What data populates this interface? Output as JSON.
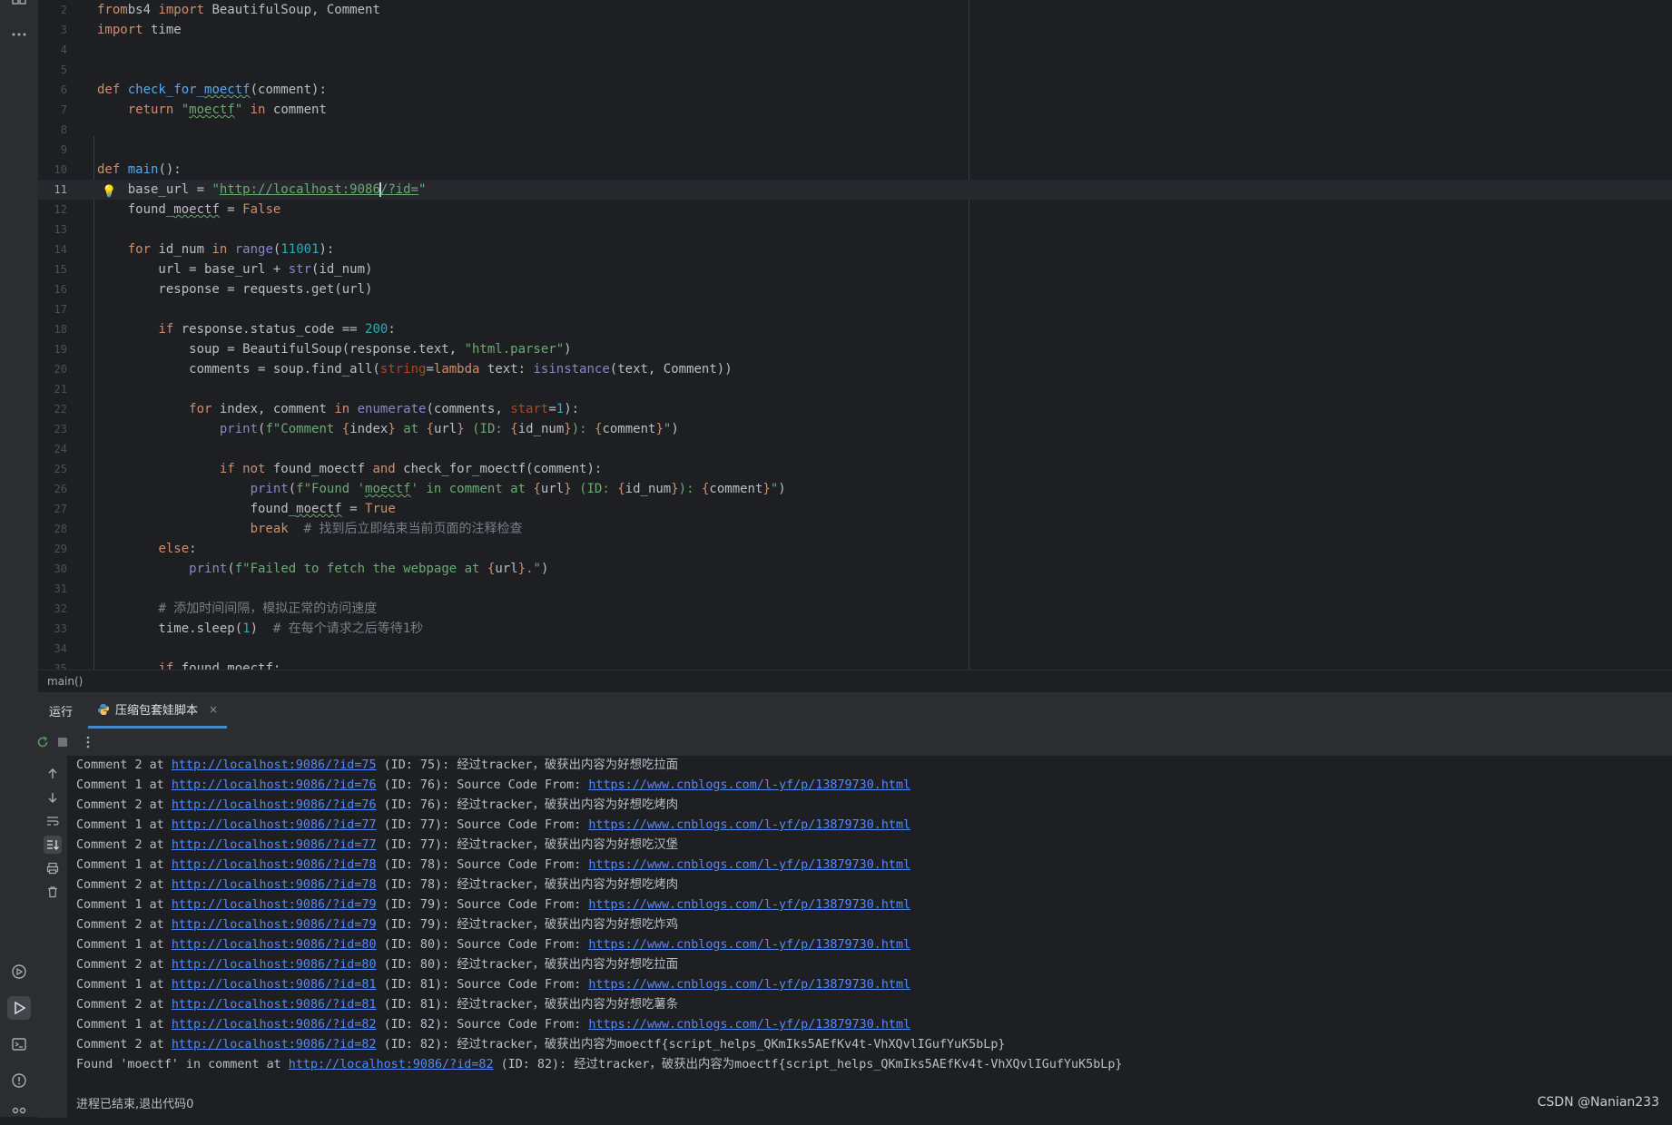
{
  "editor": {
    "lines": [
      {
        "n": "2",
        "tokens": [
          [
            "kw",
            "from"
          ],
          [
            "",
            "bs4 "
          ],
          [
            "kw",
            "import"
          ],
          [
            "",
            " BeautifulSoup, Comment"
          ]
        ]
      },
      {
        "n": "3",
        "tokens": [
          [
            "kw",
            "import"
          ],
          [
            "",
            " time"
          ]
        ]
      },
      {
        "n": "4",
        "tokens": []
      },
      {
        "n": "5",
        "tokens": []
      },
      {
        "n": "6",
        "tokens": [
          [
            "kw",
            "def "
          ],
          [
            "fn",
            "check_for_"
          ],
          [
            "fn typo",
            "moectf"
          ],
          [
            "",
            "(comment):"
          ]
        ]
      },
      {
        "n": "7",
        "tokens": [
          [
            "",
            "    "
          ],
          [
            "kw",
            "return "
          ],
          [
            "str",
            "\""
          ],
          [
            "str typo",
            "moectf"
          ],
          [
            "str",
            "\""
          ],
          [
            "kw",
            " in"
          ],
          [
            "",
            " comment"
          ]
        ]
      },
      {
        "n": "8",
        "tokens": []
      },
      {
        "n": "9",
        "tokens": []
      },
      {
        "n": "10",
        "tokens": [
          [
            "kw",
            "def "
          ],
          [
            "fn",
            "main"
          ],
          [
            "",
            "():"
          ]
        ]
      },
      {
        "n": "11",
        "tokens": [
          [
            "",
            "    base_url = "
          ],
          [
            "str",
            "\""
          ],
          [
            "str url-u",
            "http://localhost:9086"
          ],
          [
            "cursor",
            ""
          ],
          [
            "str url-u",
            "/?id="
          ],
          [
            "str",
            "\""
          ]
        ],
        "current": true
      },
      {
        "n": "12",
        "tokens": [
          [
            "",
            "    found_"
          ],
          [
            "typo",
            "moectf"
          ],
          [
            "",
            " = "
          ],
          [
            "kw",
            "False"
          ]
        ]
      },
      {
        "n": "13",
        "tokens": []
      },
      {
        "n": "14",
        "tokens": [
          [
            "",
            "    "
          ],
          [
            "kw",
            "for"
          ],
          [
            "",
            " id_num "
          ],
          [
            "kw",
            "in "
          ],
          [
            "bi",
            "range"
          ],
          [
            "",
            "("
          ],
          [
            "num",
            "1"
          ],
          [
            ", "
          ],
          [
            "num",
            "1001"
          ],
          [
            "",
            "):"
          ]
        ]
      },
      {
        "n": "15",
        "tokens": [
          [
            "",
            "        url = base_url + "
          ],
          [
            "bi",
            "str"
          ],
          [
            "",
            "(id_num)"
          ]
        ]
      },
      {
        "n": "16",
        "tokens": [
          [
            "",
            "        response = requests.get(url)"
          ]
        ]
      },
      {
        "n": "17",
        "tokens": []
      },
      {
        "n": "18",
        "tokens": [
          [
            "",
            "        "
          ],
          [
            "kw",
            "if"
          ],
          [
            "",
            " response.status_code == "
          ],
          [
            "num",
            "200"
          ],
          [
            "",
            ":"
          ]
        ]
      },
      {
        "n": "19",
        "tokens": [
          [
            "",
            "            soup = BeautifulSoup(response.text, "
          ],
          [
            "str",
            "\"html.parser\""
          ],
          [
            "",
            ")"
          ]
        ]
      },
      {
        "n": "20",
        "tokens": [
          [
            "",
            "            comments = soup.find_all("
          ],
          [
            "param",
            "string"
          ],
          [
            "",
            "="
          ],
          [
            "kw",
            "lambda"
          ],
          [
            "",
            " text: "
          ],
          [
            "bi",
            "isinstance"
          ],
          [
            "",
            "(text, Comment))"
          ]
        ]
      },
      {
        "n": "21",
        "tokens": []
      },
      {
        "n": "22",
        "tokens": [
          [
            "",
            "            "
          ],
          [
            "kw",
            "for"
          ],
          [
            "",
            " index, comment "
          ],
          [
            "kw",
            "in "
          ],
          [
            "bi",
            "enumerate"
          ],
          [
            "",
            "(comments, "
          ],
          [
            "param",
            "start"
          ],
          [
            "",
            "="
          ],
          [
            "num",
            "1"
          ],
          [
            "",
            "):"
          ]
        ]
      },
      {
        "n": "23",
        "tokens": [
          [
            "",
            "                "
          ],
          [
            "bi",
            "print"
          ],
          [
            "",
            "("
          ],
          [
            "str",
            "f\"Comment "
          ],
          [
            "kw",
            "{"
          ],
          [
            "",
            "index"
          ],
          [
            "kw",
            "}"
          ],
          [
            "str",
            " at "
          ],
          [
            "kw",
            "{"
          ],
          [
            "",
            "url"
          ],
          [
            "kw",
            "}"
          ],
          [
            "str",
            " (ID: "
          ],
          [
            "kw",
            "{"
          ],
          [
            "",
            "id_num"
          ],
          [
            "kw",
            "}"
          ],
          [
            "str",
            "): "
          ],
          [
            "kw",
            "{"
          ],
          [
            "",
            "comment"
          ],
          [
            "kw",
            "}"
          ],
          [
            "str",
            "\""
          ],
          [
            "",
            ")"
          ]
        ]
      },
      {
        "n": "24",
        "tokens": []
      },
      {
        "n": "25",
        "tokens": [
          [
            "",
            "                "
          ],
          [
            "kw",
            "if not"
          ],
          [
            "",
            " found_moectf "
          ],
          [
            "kw",
            "and"
          ],
          [
            "",
            " check_for_moectf(comment):"
          ]
        ]
      },
      {
        "n": "26",
        "tokens": [
          [
            "",
            "                    "
          ],
          [
            "bi",
            "print"
          ],
          [
            "",
            "("
          ],
          [
            "str",
            "f\"Found '"
          ],
          [
            "str typo",
            "moectf"
          ],
          [
            "str",
            "' in comment at "
          ],
          [
            "kw",
            "{"
          ],
          [
            "",
            "url"
          ],
          [
            "kw",
            "}"
          ],
          [
            "str",
            " (ID: "
          ],
          [
            "kw",
            "{"
          ],
          [
            "",
            "id_num"
          ],
          [
            "kw",
            "}"
          ],
          [
            "str",
            "): "
          ],
          [
            "kw",
            "{"
          ],
          [
            "",
            "comment"
          ],
          [
            "kw",
            "}"
          ],
          [
            "str",
            "\""
          ],
          [
            "",
            ")"
          ]
        ]
      },
      {
        "n": "27",
        "tokens": [
          [
            "",
            "                    found_"
          ],
          [
            "typo",
            "moectf"
          ],
          [
            "",
            " = "
          ],
          [
            "kw",
            "True"
          ]
        ]
      },
      {
        "n": "28",
        "tokens": [
          [
            "",
            "                    "
          ],
          [
            "kw",
            "break"
          ],
          [
            "",
            "  "
          ],
          [
            "cmt",
            "# 找到后立即结束当前页面的注释检查"
          ]
        ]
      },
      {
        "n": "29",
        "tokens": [
          [
            "",
            "        "
          ],
          [
            "kw",
            "else"
          ],
          [
            "",
            ":"
          ]
        ]
      },
      {
        "n": "30",
        "tokens": [
          [
            "",
            "            "
          ],
          [
            "bi",
            "print"
          ],
          [
            "",
            "("
          ],
          [
            "str",
            "f\"Failed to fetch the webpage at "
          ],
          [
            "kw",
            "{"
          ],
          [
            "",
            "url"
          ],
          [
            "kw",
            "}"
          ],
          [
            "str",
            ".\""
          ],
          [
            "",
            ")"
          ]
        ]
      },
      {
        "n": "31",
        "tokens": []
      },
      {
        "n": "32",
        "tokens": [
          [
            "",
            "        "
          ],
          [
            "cmt",
            "# 添加时间间隔，模拟正常的访问速度"
          ]
        ]
      },
      {
        "n": "33",
        "tokens": [
          [
            "",
            "        time.sleep("
          ],
          [
            "num",
            "1"
          ],
          [
            "",
            ")  "
          ],
          [
            "cmt",
            "# 在每个请求之后等待1秒"
          ]
        ]
      },
      {
        "n": "34",
        "tokens": []
      },
      {
        "n": "35",
        "tokens": [
          [
            "",
            "        "
          ],
          [
            "kw",
            "if"
          ],
          [
            "",
            " found_moectf:"
          ]
        ]
      }
    ]
  },
  "breadcrumb": "main()",
  "run_panel": {
    "title": "运行",
    "tab_label": "压缩包套娃脚本",
    "tab_close": "×"
  },
  "console": {
    "lines": [
      {
        "pre": "Comment 2 at ",
        "link": "http://localhost:9086/?id=75",
        "post": " (ID: 75): 经过tracker，破获出内容为好想吃拉面"
      },
      {
        "pre": "Comment 1 at ",
        "link": "http://localhost:9086/?id=76",
        "post": " (ID: 76): Source Code From: ",
        "link2": "https://www.cnblogs.com/l-yf/p/13879730.html"
      },
      {
        "pre": "Comment 2 at ",
        "link": "http://localhost:9086/?id=76",
        "post": " (ID: 76): 经过tracker，破获出内容为好想吃烤肉"
      },
      {
        "pre": "Comment 1 at ",
        "link": "http://localhost:9086/?id=77",
        "post": " (ID: 77): Source Code From: ",
        "link2": "https://www.cnblogs.com/l-yf/p/13879730.html"
      },
      {
        "pre": "Comment 2 at ",
        "link": "http://localhost:9086/?id=77",
        "post": " (ID: 77): 经过tracker，破获出内容为好想吃汉堡"
      },
      {
        "pre": "Comment 1 at ",
        "link": "http://localhost:9086/?id=78",
        "post": " (ID: 78): Source Code From: ",
        "link2": "https://www.cnblogs.com/l-yf/p/13879730.html"
      },
      {
        "pre": "Comment 2 at ",
        "link": "http://localhost:9086/?id=78",
        "post": " (ID: 78): 经过tracker，破获出内容为好想吃烤肉"
      },
      {
        "pre": "Comment 1 at ",
        "link": "http://localhost:9086/?id=79",
        "post": " (ID: 79): Source Code From: ",
        "link2": "https://www.cnblogs.com/l-yf/p/13879730.html"
      },
      {
        "pre": "Comment 2 at ",
        "link": "http://localhost:9086/?id=79",
        "post": " (ID: 79): 经过tracker，破获出内容为好想吃炸鸡"
      },
      {
        "pre": "Comment 1 at ",
        "link": "http://localhost:9086/?id=80",
        "post": " (ID: 80): Source Code From: ",
        "link2": "https://www.cnblogs.com/l-yf/p/13879730.html"
      },
      {
        "pre": "Comment 2 at ",
        "link": "http://localhost:9086/?id=80",
        "post": " (ID: 80): 经过tracker，破获出内容为好想吃拉面"
      },
      {
        "pre": "Comment 1 at ",
        "link": "http://localhost:9086/?id=81",
        "post": " (ID: 81): Source Code From: ",
        "link2": "https://www.cnblogs.com/l-yf/p/13879730.html"
      },
      {
        "pre": "Comment 2 at ",
        "link": "http://localhost:9086/?id=81",
        "post": " (ID: 81): 经过tracker，破获出内容为好想吃薯条"
      },
      {
        "pre": "Comment 1 at ",
        "link": "http://localhost:9086/?id=82",
        "post": " (ID: 82): Source Code From: ",
        "link2": "https://www.cnblogs.com/l-yf/p/13879730.html"
      },
      {
        "pre": "Comment 2 at ",
        "link": "http://localhost:9086/?id=82",
        "post": " (ID: 82): 经过tracker，破获出内容为moectf{script_helps_QKmIks5AEfKv4t-VhXQvlIGufYuK5bLp}"
      },
      {
        "pre": "Found 'moectf' in comment at ",
        "link": "http://localhost:9086/?id=82",
        "post": " (ID: 82): 经过tracker，破获出内容为moectf{script_helps_QKmIks5AEfKv4t-VhXQvlIGufYuK5bLp}"
      }
    ],
    "exit_message": "进程已结束,退出代码0"
  },
  "watermark": "CSDN @Nanian233"
}
